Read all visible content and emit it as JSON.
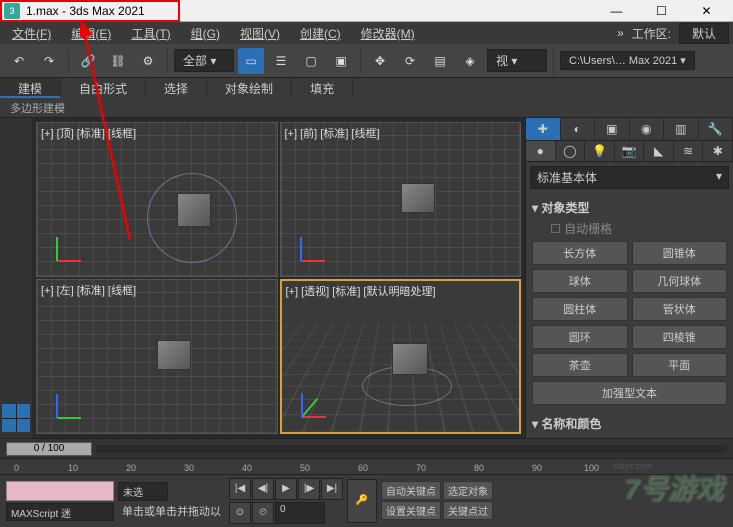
{
  "titlebar": {
    "title": "1.max - 3ds Max 2021",
    "app_icon": "3"
  },
  "menu": {
    "file": "文件(F)",
    "edit": "编辑(E)",
    "tools": "工具(T)",
    "group": "组(G)",
    "view": "视图(V)",
    "create": "创建(C)",
    "modifiers": "修改器(M)",
    "more": "»",
    "ws_label": "工作区:",
    "ws_value": "默认"
  },
  "toolbar": {
    "all": "全部",
    "path": "C:\\Users\\… Max 2021"
  },
  "ribbon": {
    "tabs": [
      "建模",
      "自由形式",
      "选择",
      "对象绘制",
      "填充"
    ],
    "sub": "多边形建模"
  },
  "viewports": {
    "tl": "[+] [顶] [标准] [线框]",
    "tr": "[+] [前] [标准] [线框]",
    "bl": "[+] [左] [标准] [线框]",
    "br": "[+] [透视] [标准] [默认明暗处理]"
  },
  "cmdpanel": {
    "dropdown": "标准基本体",
    "rollout_objtype": "对象类型",
    "autogrid": "自动栅格",
    "buttons": [
      "长方体",
      "圆锥体",
      "球体",
      "几何球体",
      "圆柱体",
      "管状体",
      "圆环",
      "四棱锥",
      "茶壶",
      "平面",
      "加强型文本"
    ],
    "rollout_name": "名称和颜色"
  },
  "timeline": {
    "slider": "0 / 100",
    "ticks": [
      "0",
      "10",
      "20",
      "30",
      "40",
      "50",
      "60",
      "70",
      "80",
      "90",
      "100"
    ]
  },
  "bottom": {
    "maxscript": "MAXScript 迷",
    "undo": "未选",
    "status": "单击或单击并拖动以",
    "autokey": "自动关键点",
    "selkey": "选定对象",
    "setkey": "设置关键点",
    "keyfilter": "关键点过",
    "frame": "0"
  },
  "watermark": "7号游戏",
  "watermark2": "xlayx.com"
}
